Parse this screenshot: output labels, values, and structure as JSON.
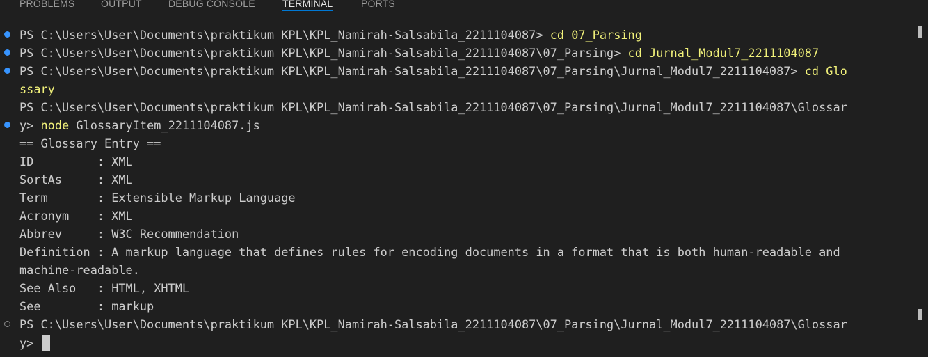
{
  "tabs": [
    {
      "label": "PROBLEMS",
      "active": false
    },
    {
      "label": "OUTPUT",
      "active": false
    },
    {
      "label": "DEBUG CONSOLE",
      "active": false
    },
    {
      "label": "TERMINAL",
      "active": true
    },
    {
      "label": "PORTS",
      "active": false
    }
  ],
  "terminal": {
    "lines": [
      {
        "prompt": "PS C:\\Users\\User\\Documents\\praktikum KPL\\KPL_Namirah-Salsabila_2211104087> ",
        "command": "cd 07_Parsing",
        "status": "success"
      },
      {
        "prompt": "PS C:\\Users\\User\\Documents\\praktikum KPL\\KPL_Namirah-Salsabila_2211104087\\07_Parsing> ",
        "command": "cd Jurnal_Modul7_2211104087",
        "status": "success"
      },
      {
        "prompt": "PS C:\\Users\\User\\Documents\\praktikum KPL\\KPL_Namirah-Salsabila_2211104087\\07_Parsing\\Jurnal_Modul7_2211104087> ",
        "command": "cd Glo",
        "status": "success"
      },
      {
        "text": "ssary"
      },
      {
        "text": "PS C:\\Users\\User\\Documents\\praktikum KPL\\KPL_Namirah-Salsabila_2211104087\\07_Parsing\\Jurnal_Modul7_2211104087\\Glossar"
      },
      {
        "prompt": "y> ",
        "command": "node",
        "rest": " GlossaryItem_2211104087.js",
        "status": "success"
      },
      {
        "text": "== Glossary Entry =="
      },
      {
        "text": "ID         : XML"
      },
      {
        "text": "SortAs     : XML"
      },
      {
        "text": "Term       : Extensible Markup Language"
      },
      {
        "text": "Acronym    : XML"
      },
      {
        "text": "Abbrev     : W3C Recommendation"
      },
      {
        "text": "Definition : A markup language that defines rules for encoding documents in a format that is both human-readable and"
      },
      {
        "text": "machine-readable."
      },
      {
        "text": "See Also   : HTML, XHTML"
      },
      {
        "text": "See        : markup"
      },
      {
        "text": "PS C:\\Users\\User\\Documents\\praktikum KPL\\KPL_Namirah-Salsabila_2211104087\\07_Parsing\\Jurnal_Modul7_2211104087\\Glossar",
        "status": "pending"
      },
      {
        "prompt": "y> ",
        "cursor": true
      }
    ]
  },
  "colors": {
    "background": "#1f1f1f",
    "text": "#cccccc",
    "command": "#f1f17a",
    "success_decoration": "#3794ff",
    "pending_decoration": "#8b8b8b",
    "active_tab_underline": "#0078d4"
  }
}
